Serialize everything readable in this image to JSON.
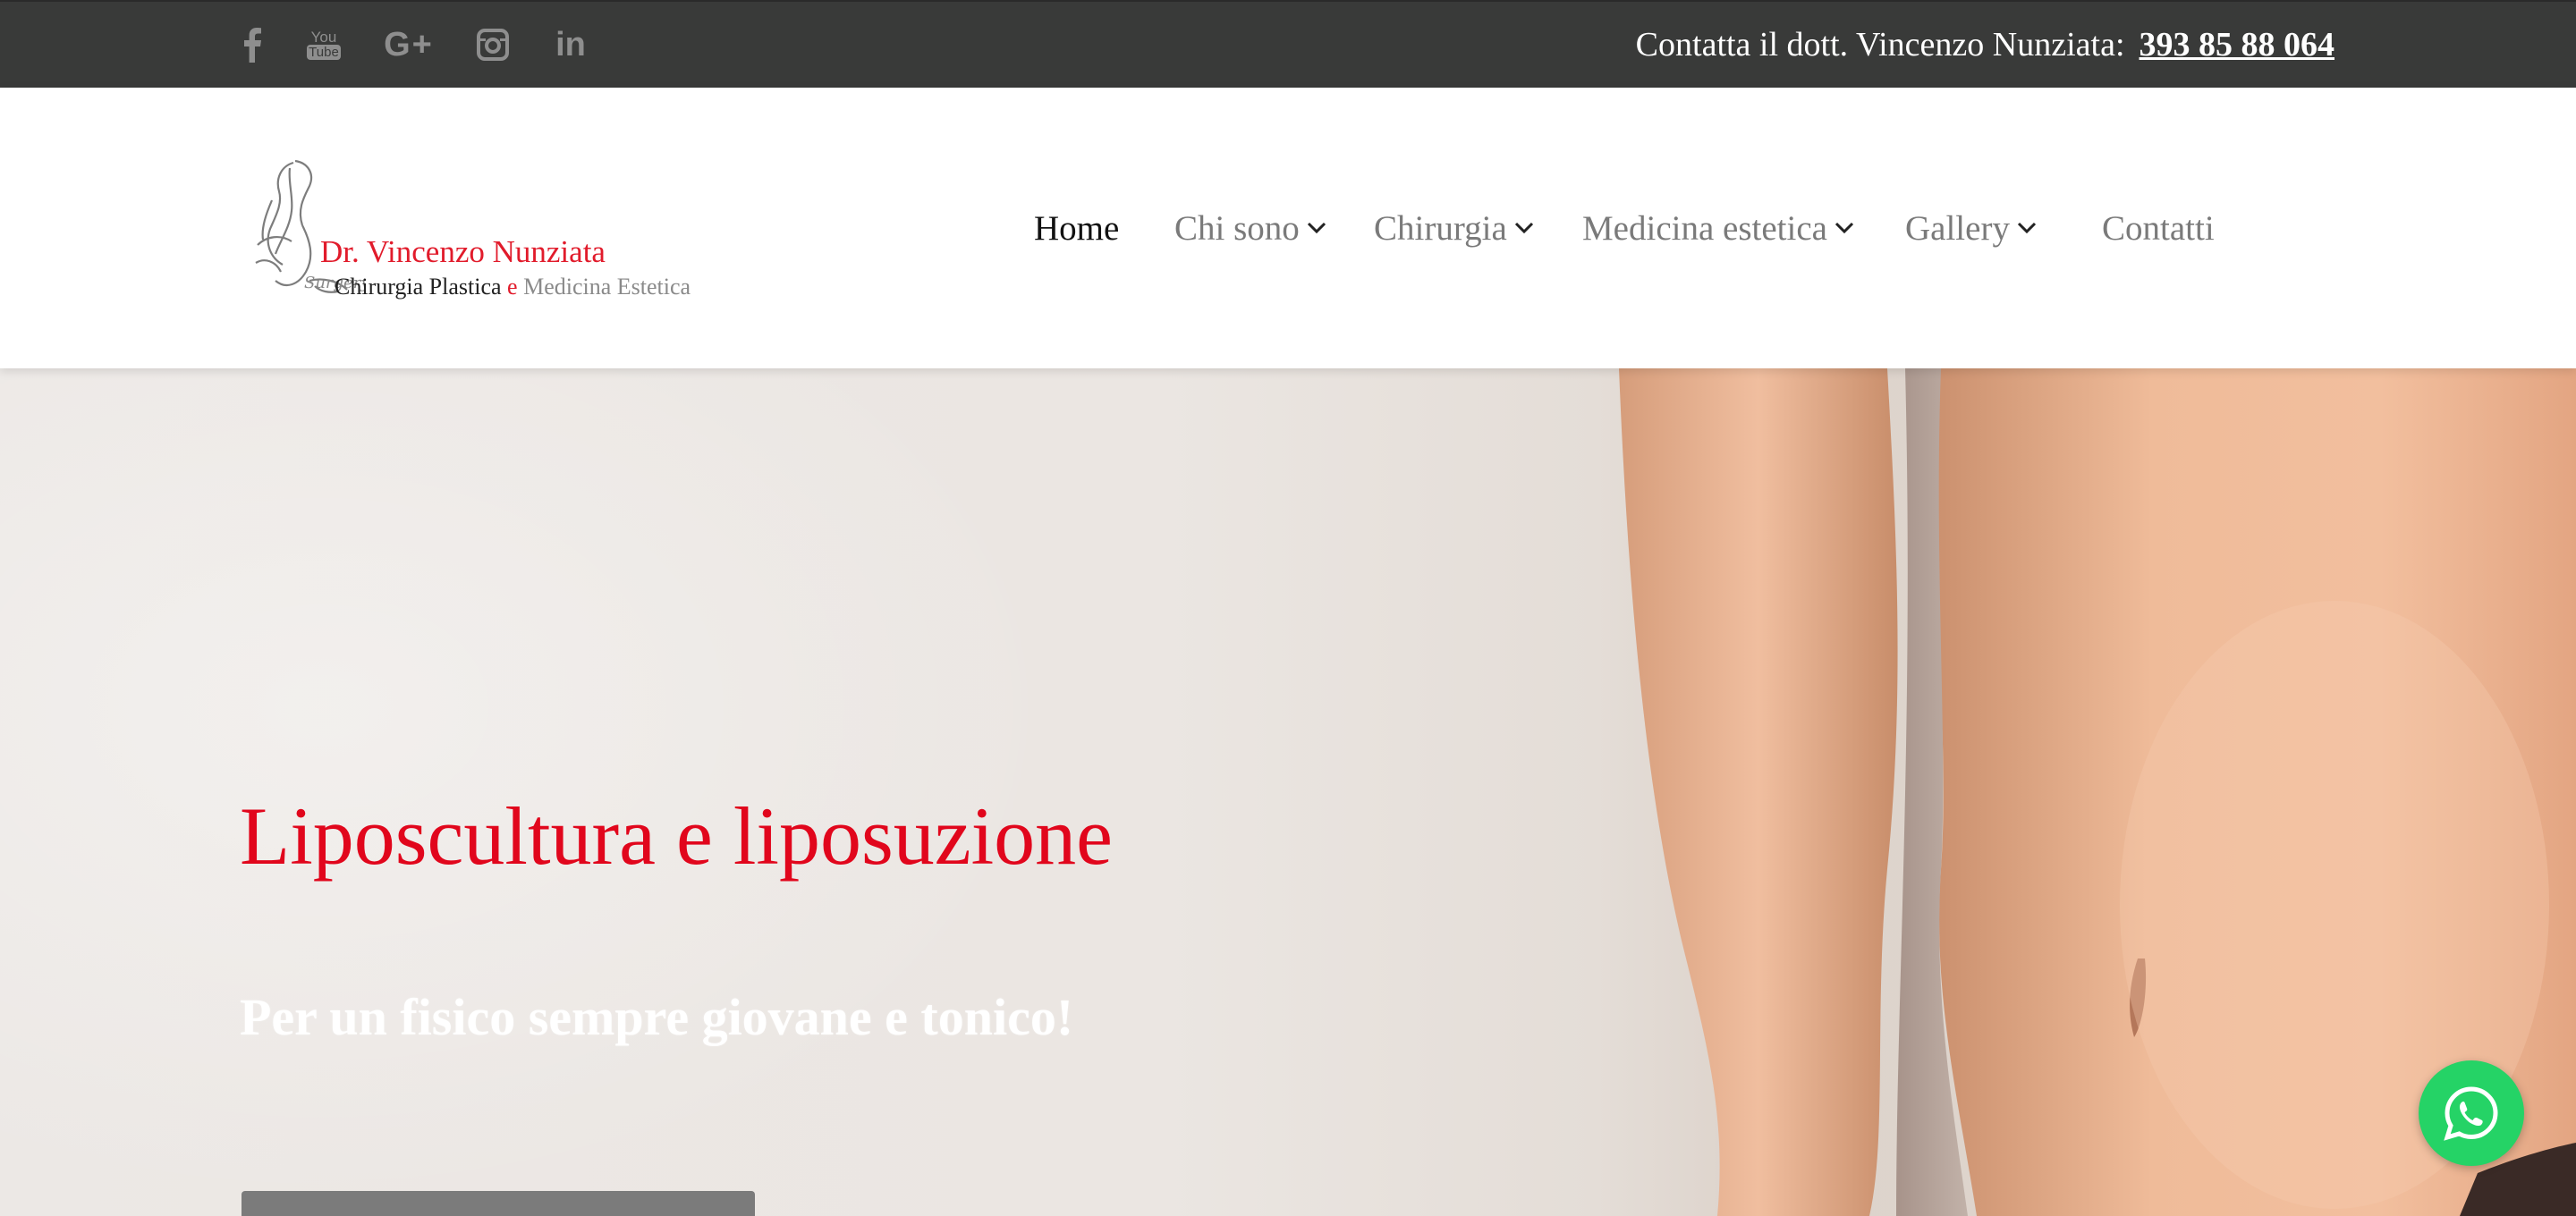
{
  "topbar": {
    "social_icons": [
      "facebook-icon",
      "youtube-icon",
      "google-plus-icon",
      "instagram-icon",
      "linkedin-icon"
    ],
    "youtube_text_top": "You",
    "youtube_text_bottom": "Tube",
    "google_plus_text": "G+",
    "linkedin_text": "in",
    "contact_label": "Contatta il dott. Vincenzo Nunziata:",
    "phone": "393 85 88 064"
  },
  "logo": {
    "name": "Dr. Vincenzo Nunziata",
    "sub_part1": "Chirurgia Plastica ",
    "sub_e": "e",
    "sub_part2": " Medicina Estetica"
  },
  "nav": {
    "items": [
      {
        "label": "Home",
        "active": true,
        "has_dropdown": false
      },
      {
        "label": "Chi sono",
        "active": false,
        "has_dropdown": true
      },
      {
        "label": "Chirurgia",
        "active": false,
        "has_dropdown": true
      },
      {
        "label": "Medicina estetica",
        "active": false,
        "has_dropdown": true
      },
      {
        "label": "Gallery",
        "active": false,
        "has_dropdown": true
      },
      {
        "label": "Contatti",
        "active": false,
        "has_dropdown": false
      }
    ]
  },
  "hero": {
    "title": "Liposcultura e liposuzione",
    "subtitle": "Per un fisico sempre giovane e tonico!"
  },
  "colors": {
    "topbar_bg": "#393a39",
    "accent_red": "#e1061c",
    "nav_text": "#7a7a7a",
    "whatsapp_green": "#25d366"
  }
}
